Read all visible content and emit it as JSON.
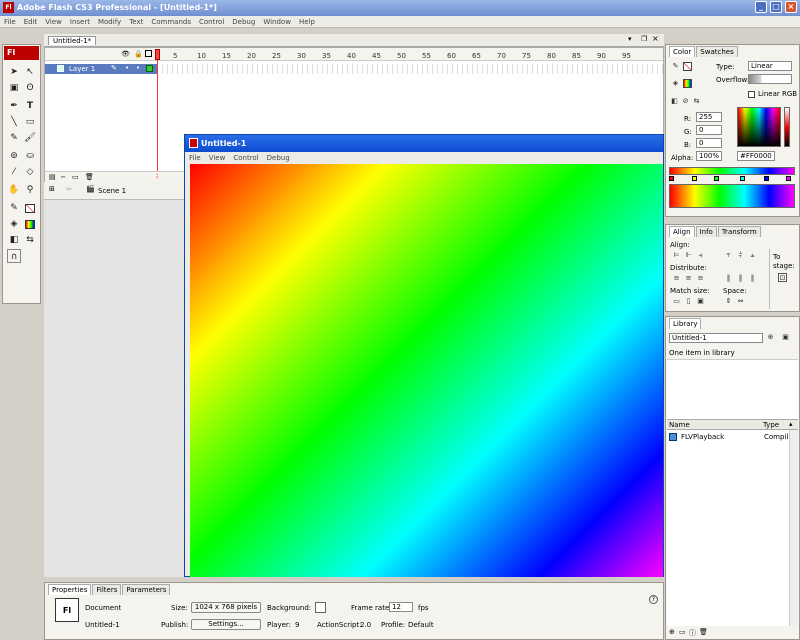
{
  "app": {
    "title": "Adobe Flash CS3 Professional - [Untitled-1*]",
    "logo": "Fl"
  },
  "menus": [
    "File",
    "Edit",
    "View",
    "Insert",
    "Modify",
    "Text",
    "Commands",
    "Control",
    "Debug",
    "Window",
    "Help"
  ],
  "document": {
    "tab": "Untitled-1*"
  },
  "timeline": {
    "layer": "Layer 1",
    "frames": [
      "5",
      "10",
      "15",
      "20",
      "25",
      "30",
      "35",
      "40",
      "45",
      "50",
      "55",
      "60",
      "65",
      "70",
      "75",
      "80",
      "85",
      "90",
      "95"
    ],
    "scene": "Scene 1"
  },
  "player": {
    "title": "Untitled-1",
    "menus": [
      "File",
      "View",
      "Control",
      "Debug"
    ]
  },
  "color_panel": {
    "tabs": [
      "Color",
      "Swatches"
    ],
    "type_label": "Type:",
    "type_value": "Linear",
    "overflow_label": "Overflow:",
    "linear_rgb": "Linear RGB",
    "r_label": "R:",
    "r": "255",
    "g_label": "G:",
    "g": "0",
    "b_label": "B:",
    "b": "0",
    "alpha_label": "Alpha:",
    "alpha": "100%",
    "hex": "#FF0000"
  },
  "align_panel": {
    "tabs": [
      "Align",
      "Info",
      "Transform"
    ],
    "align_label": "Align:",
    "distribute_label": "Distribute:",
    "match_label": "Match size:",
    "space_label": "Space:",
    "to_stage": "To stage:"
  },
  "library_panel": {
    "tab": "Library",
    "doc": "Untitled-1",
    "count": "One item in library",
    "col_name": "Name",
    "col_type": "Type",
    "item_name": "FLVPlayback",
    "item_type": "Compil"
  },
  "properties": {
    "tabs": [
      "Properties",
      "Filters",
      "Parameters"
    ],
    "logo": "Fl",
    "kind": "Document",
    "doc_name": "Untitled-1",
    "size_label": "Size:",
    "size_value": "1024 x 768 pixels",
    "bg_label": "Background:",
    "fr_label": "Frame rate:",
    "fr_value": "12",
    "fps": "fps",
    "publish_label": "Publish:",
    "settings": "Settings...",
    "player_label": "Player:",
    "player_value": "9",
    "as_label": "ActionScript:",
    "as_value": "2.0",
    "profile_label": "Profile:",
    "profile_value": "Default"
  }
}
